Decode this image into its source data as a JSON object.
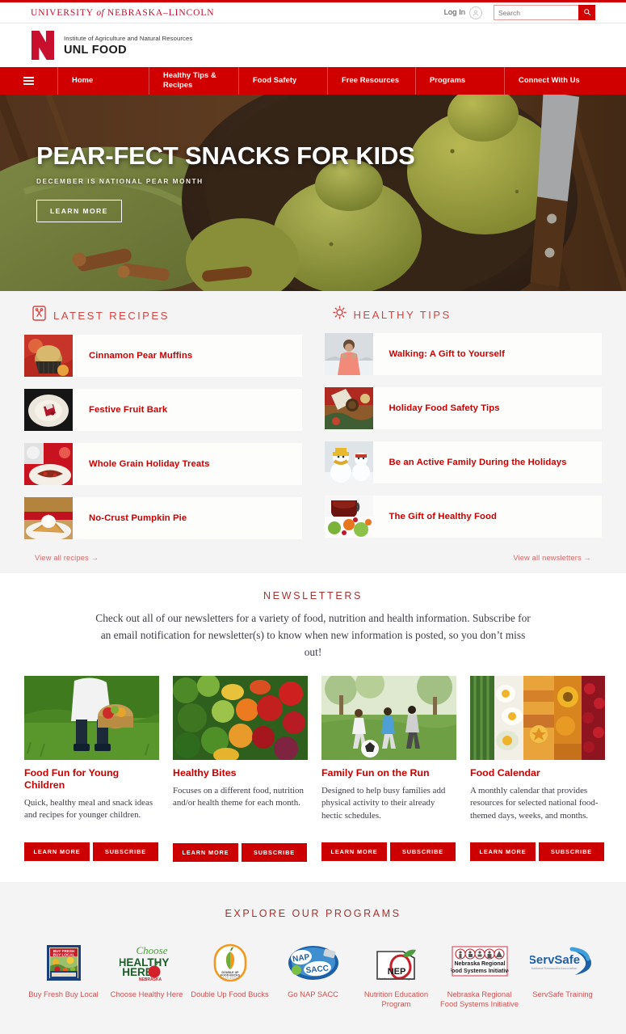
{
  "topbar": {
    "wordmark_pre": "UNIVERSITY ",
    "wordmark_italic": "of",
    "wordmark_post": " NEBRASKA–LINCOLN",
    "login_label": "Log In",
    "login_icon": "user-avatar-icon",
    "search_placeholder": "Search",
    "search_value": "",
    "search_icon": "search-icon"
  },
  "brand": {
    "logo_icon": "nebraska-n-logo",
    "institute": "Institute of Agriculture and Natural Resources",
    "site_title": "UNL FOOD"
  },
  "nav": {
    "menu_icon": "hamburger-menu-icon",
    "items": [
      {
        "label": "Home"
      },
      {
        "label": "Healthy Tips & Recipes"
      },
      {
        "label": "Food Safety"
      },
      {
        "label": "Free Resources"
      },
      {
        "label": "Programs"
      },
      {
        "label": "Connect With Us"
      }
    ]
  },
  "hero": {
    "title": "PEAR-FECT SNACKS FOR KIDS",
    "subtitle": "DECEMBER IS NATIONAL PEAR MONTH",
    "cta_label": "LEARN MORE",
    "image_alt": "pears-in-bowl-with-cinnamon-and-knife"
  },
  "recipes": {
    "icon": "recipe-card-icon",
    "heading": "LATEST RECIPES",
    "items": [
      {
        "title": "Cinnamon Pear Muffins",
        "thumb": "muffin-thumbnail"
      },
      {
        "title": "Festive Fruit Bark",
        "thumb": "fruit-bark-plate-thumbnail"
      },
      {
        "title": "Whole Grain Holiday Treats",
        "thumb": "holiday-treats-thumbnail"
      },
      {
        "title": "No-Crust Pumpkin Pie",
        "thumb": "pumpkin-pie-thumbnail"
      }
    ],
    "view_all": "View all recipes"
  },
  "tips": {
    "icon": "sun-icon",
    "heading": "HEALTHY TIPS",
    "items": [
      {
        "title": "Walking: A Gift to Yourself",
        "thumb": "woman-walking-winter-thumbnail"
      },
      {
        "title": "Holiday Food Safety Tips",
        "thumb": "holiday-table-thumbnail"
      },
      {
        "title": "Be an Active Family During the Holidays",
        "thumb": "snowmen-thumbnail"
      },
      {
        "title": "The Gift of Healthy Food",
        "thumb": "tea-and-fruit-thumbnail"
      }
    ],
    "view_all": "View all newsletters"
  },
  "newsletters": {
    "heading": "NEWSLETTERS",
    "intro": "Check out all of our newsletters for a variety of food, nutrition and health information. Subscribe for an email notification for newsletter(s) to know when new information is posted, so you don’t miss out!",
    "cards": [
      {
        "title": "Food Fun for Young Children",
        "desc": "Quick, healthy meal and snack ideas and recipes for younger children.",
        "learn_label": "LEARN MORE",
        "subscribe_label": "SUBSCRIBE",
        "image_alt": "child-holding-basket-of-produce"
      },
      {
        "title": "Healthy Bites",
        "desc": "Focuses on a different food, nutrition and/or health theme for each month.",
        "learn_label": "LEARN MORE",
        "subscribe_label": "SUBSCRIBE",
        "image_alt": "assorted-fruits-and-vegetables"
      },
      {
        "title": "Family Fun on the Run",
        "desc": "Designed to help busy families add physical activity to their already hectic schedules.",
        "learn_label": "LEARN MORE",
        "subscribe_label": "SUBSCRIBE",
        "image_alt": "family-running-in-park-with-soccer-ball"
      },
      {
        "title": "Food Calendar",
        "desc": "A monthly calendar that provides resources for selected national food-themed days, weeks, and months.",
        "learn_label": "LEARN MORE",
        "subscribe_label": "SUBSCRIBE",
        "image_alt": "collage-of-seasonal-foods"
      }
    ]
  },
  "programs": {
    "heading": "EXPLORE OUR PROGRAMS",
    "items": [
      {
        "label": "Buy Fresh Buy Local",
        "logo": "buy-fresh-buy-local-logo",
        "logo_text": "BUY FRESH BUY LOCAL"
      },
      {
        "label": "Choose Healthy Here",
        "logo": "choose-healthy-here-logo",
        "logo_text": "Choose HEALTHY HERE NEBRASKA"
      },
      {
        "label": "Double Up Food Bucks",
        "logo": "double-up-food-bucks-logo",
        "logo_text": "DOUBLE UP FOOD BUCKS"
      },
      {
        "label": "Go NAP SACC",
        "logo": "go-nap-sacc-logo",
        "logo_text": "NAP SACC"
      },
      {
        "label": "Nutrition Education Program",
        "logo": "nep-logo",
        "logo_text": "NEP Nutrition Education Program"
      },
      {
        "label": "Nebraska Regional Food Systems Initiative",
        "logo": "nebraska-regional-food-systems-initiative-logo",
        "logo_text": "Nebraska Regional Food Systems Initiative"
      },
      {
        "label": "ServSafe Training",
        "logo": "servsafe-logo",
        "logo_text": "ServSafe National Restaurant Association"
      }
    ]
  },
  "colors": {
    "brand_red": "#d00000",
    "link_red": "#cc0000",
    "heading_red": "#a83232",
    "muted_red": "#d05050",
    "feature_bg": "#f4f4f4"
  }
}
